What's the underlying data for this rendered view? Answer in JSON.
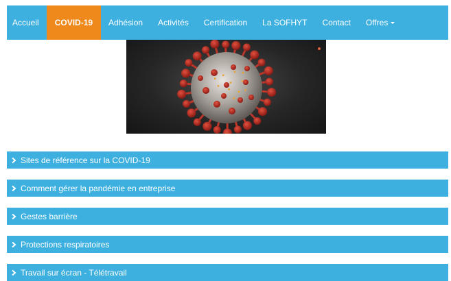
{
  "nav": {
    "items": [
      {
        "label": "Accueil"
      },
      {
        "label": "COVID-19",
        "active": true
      },
      {
        "label": "Adhésion"
      },
      {
        "label": "Activités"
      },
      {
        "label": "Certification"
      },
      {
        "label": "La SOFHYT"
      },
      {
        "label": "Contact"
      },
      {
        "label": "Offres",
        "dropdown": true
      }
    ]
  },
  "accordion": {
    "items": [
      {
        "label": "Sites de référence sur la COVID-19"
      },
      {
        "label": "Comment gérer la pandémie en entreprise"
      },
      {
        "label": "Gestes barrière"
      },
      {
        "label": "Protections respiratoires"
      },
      {
        "label": "Travail sur écran - Télétravail"
      }
    ]
  },
  "colors": {
    "nav_background": "#3eb0e0",
    "nav_active": "#f0891c",
    "accordion_background": "#3eb0e0",
    "text": "#ffffff"
  },
  "icons": {
    "accordion_toggle": "chevron-right-icon",
    "dropdown": "caret-down-icon"
  }
}
